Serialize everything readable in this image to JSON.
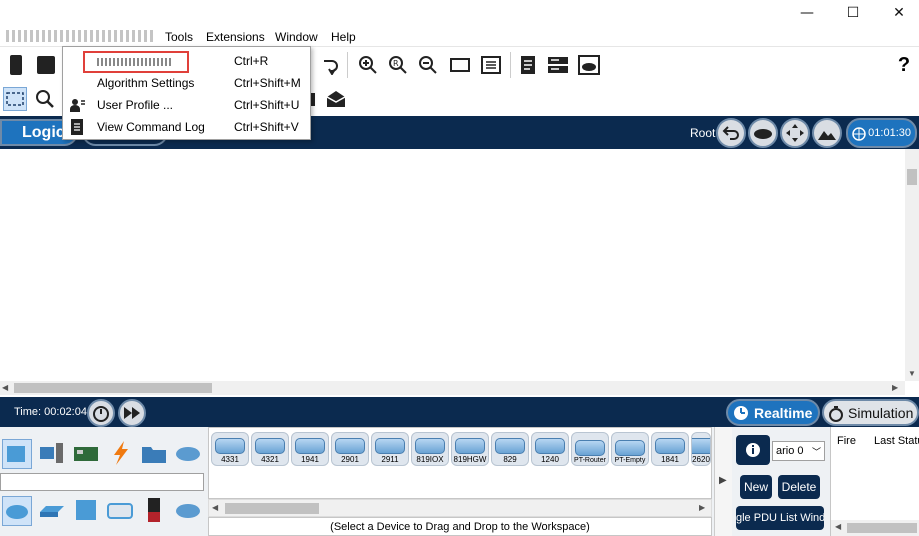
{
  "window": {
    "minimize_glyph": "—",
    "maximize_glyph": "☐",
    "close_glyph": "✕"
  },
  "menubar": {
    "items": [
      "Tools",
      "Extensions",
      "Window",
      "Help"
    ]
  },
  "dropdown": {
    "items": [
      {
        "label": "",
        "shortcut": "Ctrl+R"
      },
      {
        "label": "Algorithm Settings",
        "shortcut": "Ctrl+Shift+M"
      },
      {
        "label": "User Profile ...",
        "shortcut": "Ctrl+Shift+U"
      },
      {
        "label": "View Command Log",
        "shortcut": "Ctrl+Shift+V"
      }
    ],
    "highlight_color": "#e0403a"
  },
  "toolbar": {
    "help_glyph": "?"
  },
  "navbar": {
    "logical_tab": "Logic",
    "root_label": "Root",
    "clock": "01:01:30"
  },
  "timebar": {
    "time_text": "Time: 00:02:04",
    "realtime_label": "Realtime",
    "simulation_label": "Simulation"
  },
  "devices": {
    "models": [
      "4331",
      "4321",
      "1941",
      "2901",
      "2911",
      "819IOX",
      "819HGW",
      "829",
      "1240",
      "PT-Router",
      "PT-Empty",
      "1841",
      "2620"
    ],
    "status_text": "(Select a Device to Drag and Drop to the Workspace)"
  },
  "pdu": {
    "scenario_value": "ario 0",
    "new_label": "New",
    "delete_label": "Delete",
    "list_window_label": "gle PDU List Wind",
    "columns": [
      "Fire",
      "Last Statu"
    ]
  },
  "colors": {
    "navy": "#0b2a4f",
    "accent_blue": "#1e73be"
  }
}
